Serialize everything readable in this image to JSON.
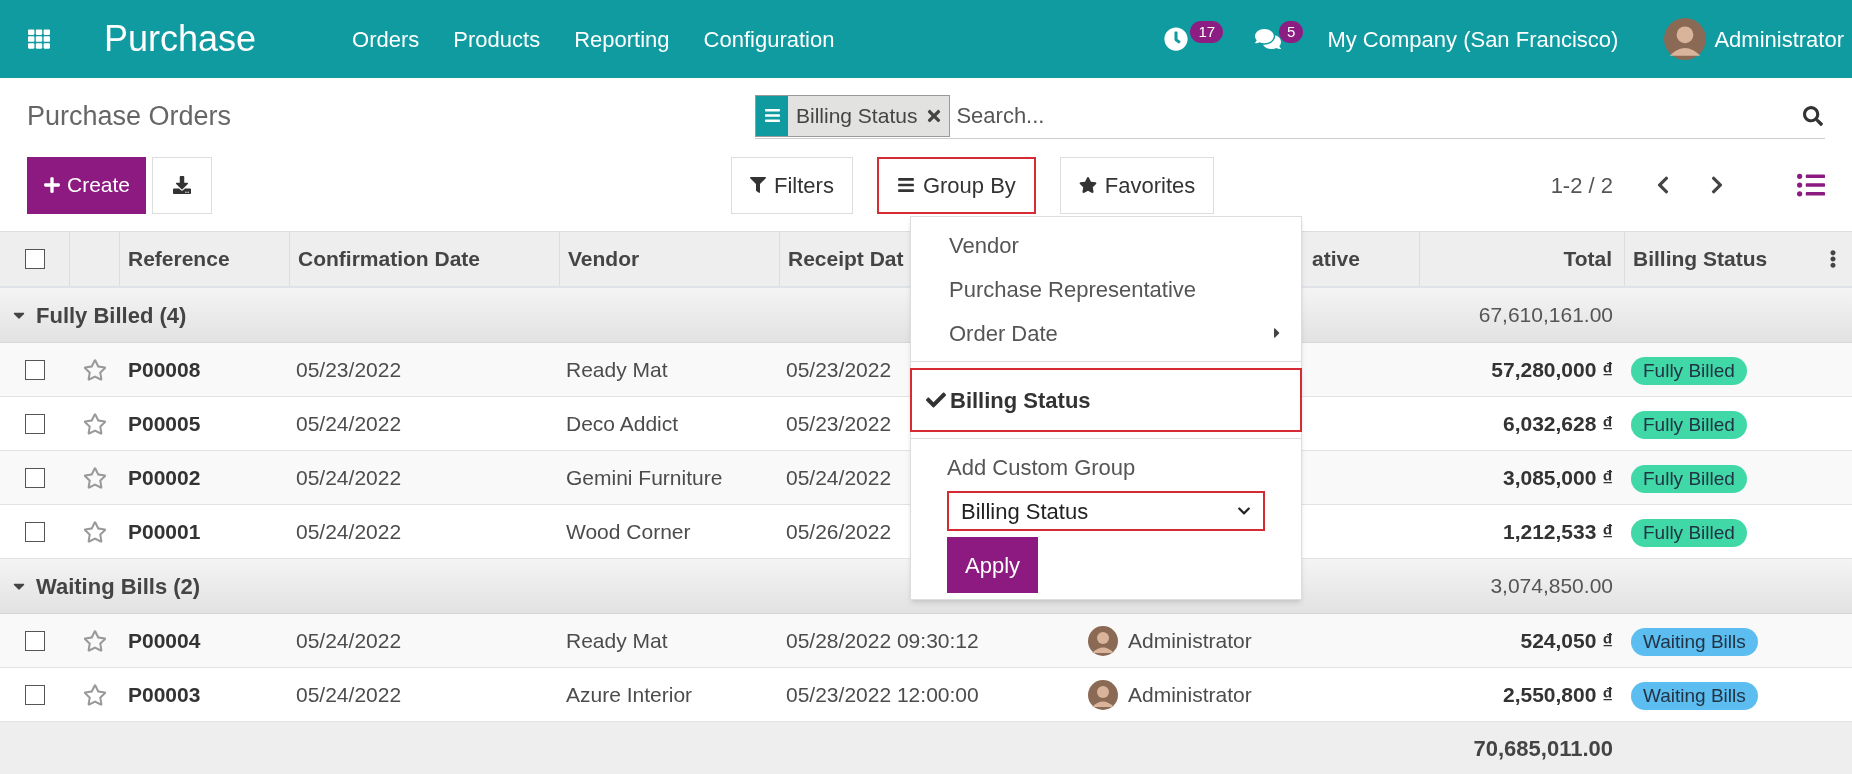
{
  "navbar": {
    "app": "Purchase",
    "menu": [
      "Orders",
      "Products",
      "Reporting",
      "Configuration"
    ],
    "activity_count": "17",
    "message_count": "5",
    "company": "My Company (San Francisco)",
    "user": "Administrator"
  },
  "control_panel": {
    "title": "Purchase Orders",
    "facets": [
      {
        "label": "Billing Status"
      }
    ],
    "search_placeholder": "Search...",
    "create": "Create",
    "search_buttons": [
      {
        "label": "Filters",
        "kind": "filter",
        "highlighted": false
      },
      {
        "label": "Group By",
        "kind": "group",
        "highlighted": true
      },
      {
        "label": "Favorites",
        "kind": "star",
        "highlighted": false
      }
    ],
    "pager": "1-2 / 2"
  },
  "table": {
    "select_all_checked": false,
    "columns": [
      "Reference",
      "Confirmation Date",
      "Vendor",
      "Receipt Dat",
      "ative",
      "Total",
      "Billing Status"
    ],
    "groups": [
      {
        "label": "Fully Billed (4)",
        "expanded": true,
        "total": "67,610,161.00",
        "rows": [
          {
            "reference": "P00008",
            "confirmation_date": "05/23/2022",
            "vendor": "Ready Mat",
            "receipt_date": "05/23/2022",
            "total": "57,280,000 ₫",
            "billing_status": "Fully Billed",
            "color": "#3fd8a6",
            "checked": false,
            "starred": false
          },
          {
            "reference": "P00005",
            "confirmation_date": "05/24/2022",
            "vendor": "Deco Addict",
            "receipt_date": "05/23/2022",
            "total": "6,032,628 ₫",
            "billing_status": "Fully Billed",
            "color": "#3fd8a6",
            "checked": false,
            "starred": false
          },
          {
            "reference": "P00002",
            "confirmation_date": "05/24/2022",
            "vendor": "Gemini Furniture",
            "receipt_date": "05/24/2022",
            "total": "3,085,000 ₫",
            "billing_status": "Fully Billed",
            "color": "#3fd8a6",
            "checked": false,
            "starred": false
          },
          {
            "reference": "P00001",
            "confirmation_date": "05/24/2022",
            "vendor": "Wood Corner",
            "receipt_date": "05/26/2022",
            "total": "1,212,533 ₫",
            "billing_status": "Fully Billed",
            "color": "#3fd8a6",
            "checked": false,
            "starred": false
          }
        ]
      },
      {
        "label": "Waiting Bills (2)",
        "expanded": true,
        "total": "3,074,850.00",
        "rows": [
          {
            "reference": "P00004",
            "confirmation_date": "05/24/2022",
            "vendor": "Ready Mat",
            "receipt_date": "05/28/2022 09:30:12",
            "representative": "Administrator",
            "total": "524,050 ₫",
            "billing_status": "Waiting Bills",
            "color": "#5cbdf0",
            "checked": false,
            "starred": false
          },
          {
            "reference": "P00003",
            "confirmation_date": "05/24/2022",
            "vendor": "Azure Interior",
            "receipt_date": "05/23/2022 12:00:00",
            "representative": "Administrator",
            "total": "2,550,800 ₫",
            "billing_status": "Waiting Bills",
            "color": "#5cbdf0",
            "checked": false,
            "starred": false
          }
        ]
      }
    ],
    "grand_total": "70,685,011.00"
  },
  "group_by_menu": {
    "items": [
      {
        "label": "Vendor",
        "checked": false,
        "submenu": false,
        "highlighted": false
      },
      {
        "label": "Purchase Representative",
        "checked": false,
        "submenu": false,
        "highlighted": false
      },
      {
        "label": "Order Date",
        "checked": false,
        "submenu": true,
        "highlighted": false
      },
      {
        "label": "Billing Status",
        "checked": true,
        "submenu": false,
        "highlighted": true
      }
    ],
    "custom_group_label": "Add Custom Group",
    "custom_group_value": "Billing Status",
    "custom_group_highlighted": true,
    "apply": "Apply"
  }
}
